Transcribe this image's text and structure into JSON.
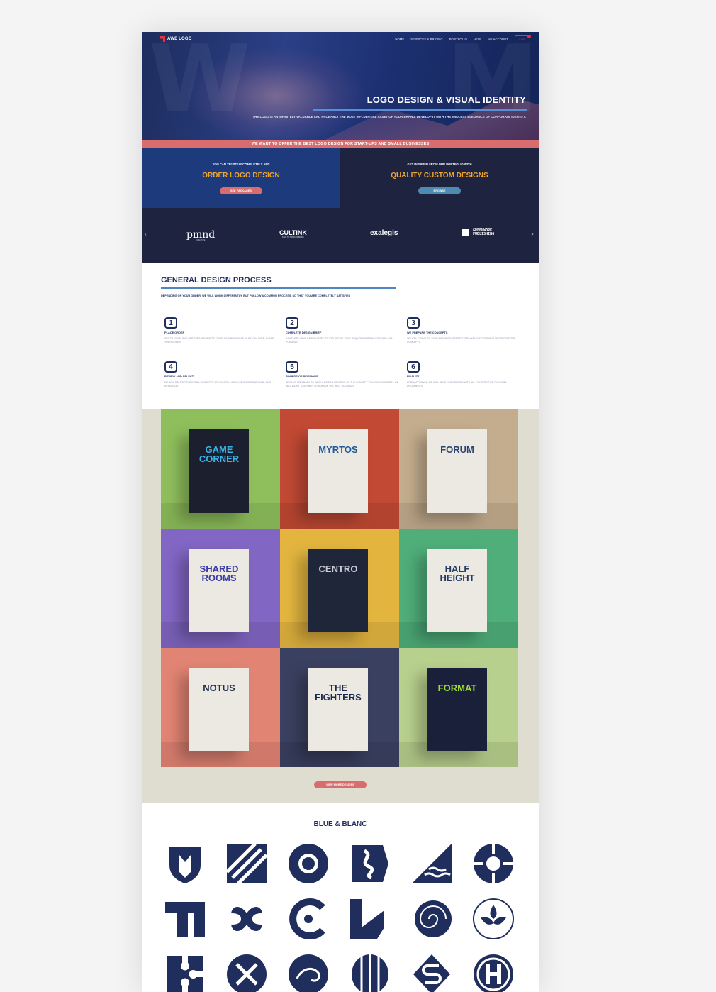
{
  "nav": {
    "brand": "AWE LOGO",
    "items": [
      "HOME",
      "SERVICES & PRICING",
      "PORTFOLIO",
      "HELP",
      "MY ACCOUNT"
    ],
    "cart_label": "CART"
  },
  "hero": {
    "title": "LOGO DESIGN & VISUAL IDENTITY",
    "subtitle": "THE LOGO IS AN INFINITELY VALUABLE AND PROBABLY THE MOST INFLUENTIAL ASSET OF YOUR BRAND. DEVELOP IT WITH THE ENDLESS ELEGANCE OF CORPORATE IDENTITY."
  },
  "ribbon": "WE WANT TO OFFER THE BEST LOGO DESIGN FOR START-UPS AND SMALL BUSINESSES",
  "cta": {
    "left": {
      "pre": "YOU CAN TRUST US COMPLETELY AND",
      "title": "ORDER LOGO DESIGN",
      "button": "SEE PACKAGES"
    },
    "right": {
      "pre": "GET INSPIRED FROM OUR PORTFOLIO WITH",
      "title": "QUALITY CUSTOM DESIGNS",
      "button": "BROWSE"
    }
  },
  "clients": {
    "prev": "‹",
    "next": "›",
    "items": [
      {
        "name": "pmnd",
        "tag": "CREATIVE"
      },
      {
        "name": "CULTINK",
        "tag": "TALK TO YOUR AUDIENCE"
      },
      {
        "name": "exalegis"
      },
      {
        "name": "GREENWORK",
        "line2": "PUBLISHING"
      }
    ]
  },
  "process": {
    "title": "GENERAL DESIGN PROCESS",
    "lead": "DEPENDING ON YOUR ORDER, WE WILL WORK DIFFERENTLY, BUT FOLLOW A COMMON PROCESS, SO THAT YOU ARE COMPLETELY SATISFIED",
    "steps": [
      {
        "num": "1",
        "title": "PLACE ORDER",
        "desc": "GET TO KNOW OUR SERVICES. DECIDE TO TRUST US AND CHOOSE WHAT YOU NEED. PLACE YOUR ORDER."
      },
      {
        "num": "2",
        "title": "COMPLETE DESIGN BRIEF",
        "desc": "COMPLETE YOUR DESIGN BRIEF. TRY TO DEFINE YOUR REQUIREMENTS AS PRECISELY AS POSSIBLE."
      },
      {
        "num": "3",
        "title": "WE PREPARE THE CONCEPTS",
        "desc": "WE WILL FOCUS ON YOUR BUSINESS, COMPETITORS AND EXPECTATIONS TO PREPARE THE CONCEPTS."
      },
      {
        "num": "4",
        "title": "REVIEW AND SELECT",
        "desc": "WE WILL DELIVER THE INITIAL CONCEPTS WITHIN 3 TO 4 DAYS, DEVELOPED AROUND OUR RESEARCH."
      },
      {
        "num": "5",
        "title": "ROUNDS OF REVISIONS",
        "desc": "SEND US FEEDBACK TO MAKE A DESIGN REVISION ON THE CONCEPT YOU HAVE CHOOSEN. WE WILL WORK TOGETHER TO ACHIEVE THE BEST SOLUTION."
      },
      {
        "num": "6",
        "title": "FINALIZE",
        "desc": "UPON APPROVAL, WE WILL SEND YOUR DESIGN WITH ALL THE SPECIFIED FILES AND DOCUMENTS."
      }
    ]
  },
  "portfolio": {
    "tiles": [
      {
        "brand": "GAME CORNER",
        "bg": "#8fbf5c",
        "card": "#1c1f2e",
        "text": "#39b3e6"
      },
      {
        "brand": "MYRTOS",
        "bg": "#c24a34",
        "card": "#ece9e3",
        "text": "#1d5a9a"
      },
      {
        "brand": "FORUM",
        "bg": "#c4ad8e",
        "card": "#ece9e3",
        "text": "#2b4370"
      },
      {
        "brand": "SHARED ROOMS",
        "bg": "#8266c4",
        "card": "#ece9e3",
        "text": "#3b3ba8"
      },
      {
        "brand": "CENTRO",
        "bg": "#e3b53f",
        "card": "#20263a",
        "text": "#c9ccd6"
      },
      {
        "brand": "HALF HEIGHT",
        "bg": "#4fae7a",
        "card": "#ece9e3",
        "text": "#223a66"
      },
      {
        "brand": "NOTUS",
        "bg": "#e28474",
        "card": "#ece9e3",
        "text": "#23304e"
      },
      {
        "brand": "THE FIGHTERS",
        "bg": "#3a4160",
        "card": "#ece9e3",
        "text": "#1d2b4e"
      },
      {
        "brand": "FORMAT",
        "bg": "#b8d08e",
        "card": "#1a1f3a",
        "text": "#9ddf2e"
      }
    ],
    "button": "VIEW MORE DESIGNS"
  },
  "blue_blanc": {
    "title": "BLUE & BLANC",
    "color": "#1f2e5c",
    "icons": [
      "shield-face-icon",
      "stairs-tile-icon",
      "sunburst-icon",
      "river-square-icon",
      "triangle-waves-icon",
      "spiral-rosette-icon",
      "block-m-icon",
      "x-petals-icon",
      "c-swirl-icon",
      "arrow-corner-icon",
      "nautilus-icon",
      "lily-seal-icon",
      "puzzle-icon",
      "x-bones-icon",
      "chameleon-icon",
      "striped-globe-icon",
      "s-road-icon",
      "h-circle-icon"
    ]
  }
}
